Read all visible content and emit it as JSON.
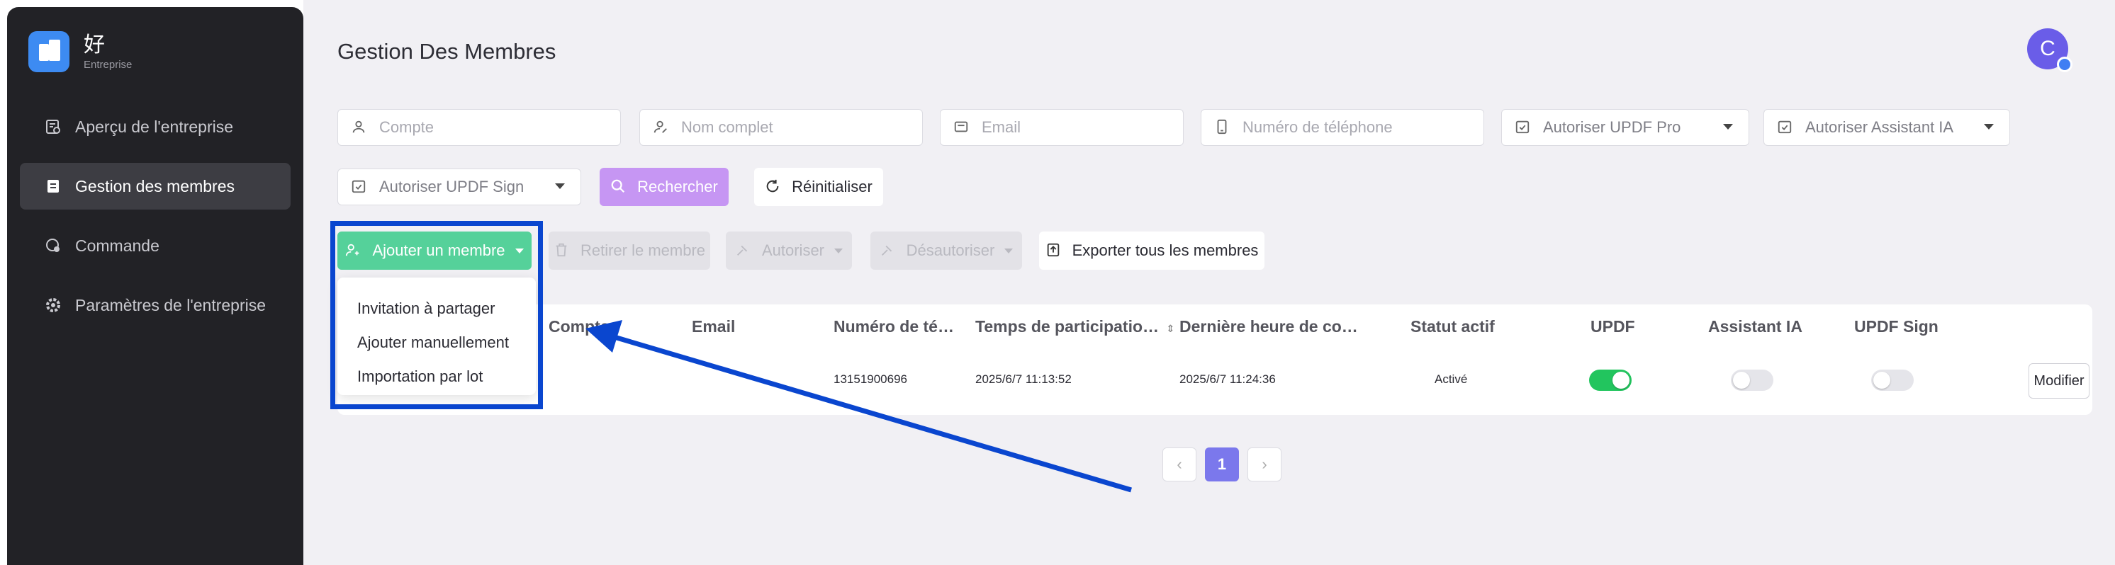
{
  "brand": {
    "name": "好",
    "subtitle": "Entreprise"
  },
  "sidebar": {
    "items": [
      {
        "label": "Aperçu de l'entreprise",
        "icon": "overview-icon",
        "active": false
      },
      {
        "label": "Gestion des membres",
        "icon": "members-icon",
        "active": true
      },
      {
        "label": "Commande",
        "icon": "order-icon",
        "active": false
      },
      {
        "label": "Paramètres de l'entreprise",
        "icon": "gear-icon",
        "active": false
      }
    ]
  },
  "header": {
    "title": "Gestion Des Membres",
    "avatar_letter": "C"
  },
  "filters": {
    "account_placeholder": "Compte",
    "fullname_placeholder": "Nom complet",
    "email_placeholder": "Email",
    "phone_placeholder": "Numéro de téléphone",
    "updf_pro_select": "Autoriser UPDF Pro",
    "ai_assistant_select": "Autoriser Assistant IA",
    "updf_sign_select": "Autoriser UPDF Sign",
    "search_label": "Rechercher",
    "reset_label": "Réinitialiser"
  },
  "toolbar": {
    "add_member": "Ajouter un membre",
    "remove_member": "Retirer le membre",
    "authorize": "Autoriser",
    "deauthorize": "Désautoriser",
    "export_all": "Exporter tous les membres"
  },
  "dropdown": {
    "items": [
      "Invitation à partager",
      "Ajouter manuellement",
      "Importation par lot"
    ]
  },
  "table": {
    "columns": [
      "Compte",
      "Email",
      "Numéro de té…",
      "Temps de participatio…",
      "Dernière heure de co…",
      "Statut actif",
      "UPDF",
      "Assistant IA",
      "UPDF Sign"
    ],
    "rows": [
      {
        "account": "",
        "email": "",
        "phone": "13151900696",
        "join_time": "2025/6/7 11:13:52",
        "last_login": "2025/6/7 11:24:36",
        "status": "Activé",
        "updf": true,
        "assistant_ia": false,
        "updf_sign": false,
        "action": "Modifier"
      }
    ]
  },
  "pagination": {
    "current": "1",
    "prev": "‹",
    "next": "›"
  },
  "colors": {
    "accent": "#7b78ec",
    "add_button": "#55d19a",
    "search_button": "#c696f3",
    "highlight": "#0a46cf",
    "toggle_on": "#22c55e"
  }
}
